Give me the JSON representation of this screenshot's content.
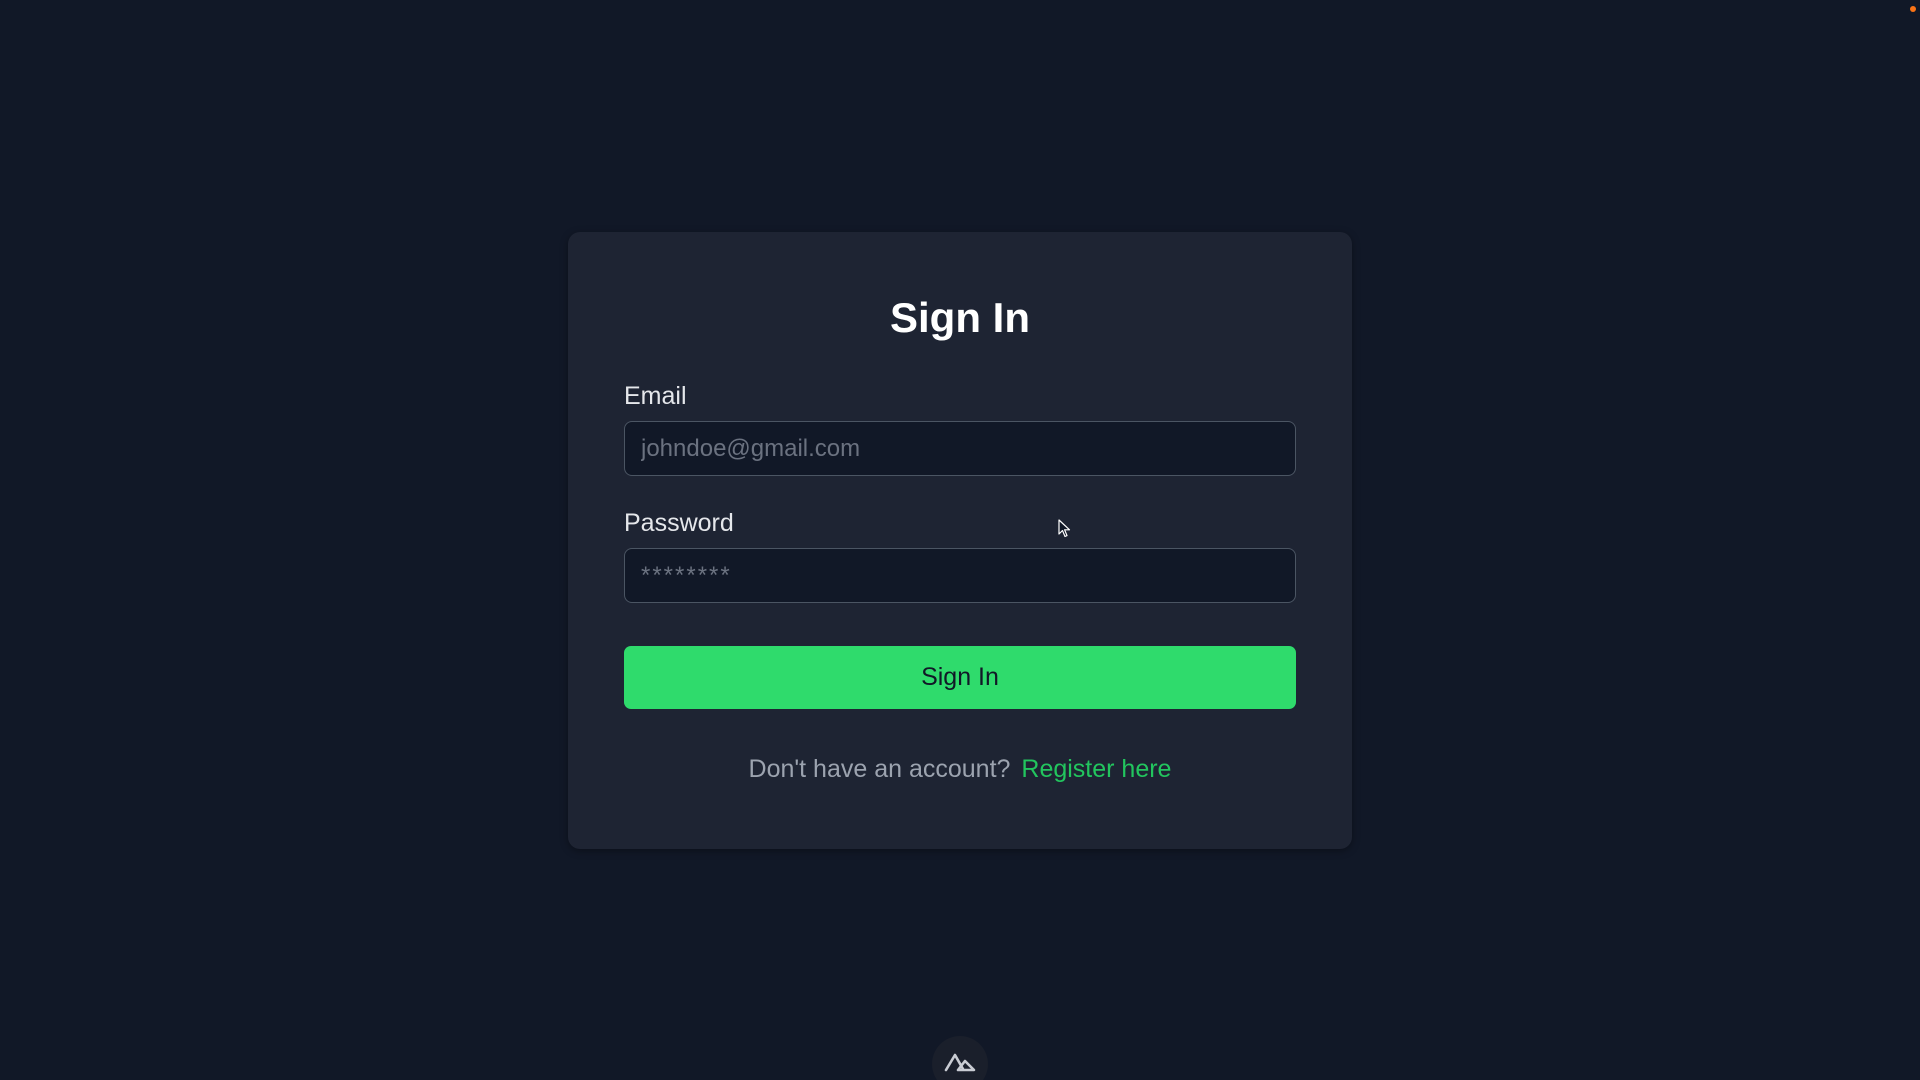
{
  "signin": {
    "title": "Sign In",
    "email": {
      "label": "Email",
      "placeholder": "johndoe@gmail.com",
      "value": ""
    },
    "password": {
      "label": "Password",
      "placeholder": "********",
      "value": ""
    },
    "submit_label": "Sign In",
    "register_prompt": "Don't have an account?",
    "register_link": "Register here"
  },
  "icons": {
    "logo": "nuxt-logo-icon",
    "cursor": "mouse-pointer-icon",
    "status": "status-dot-icon"
  },
  "colors": {
    "background": "#111827",
    "card": "#1e2433",
    "input_background": "#111827",
    "accent_button": "#2fdb6c",
    "link": "#22c55e",
    "muted_text": "#9ca3af"
  }
}
